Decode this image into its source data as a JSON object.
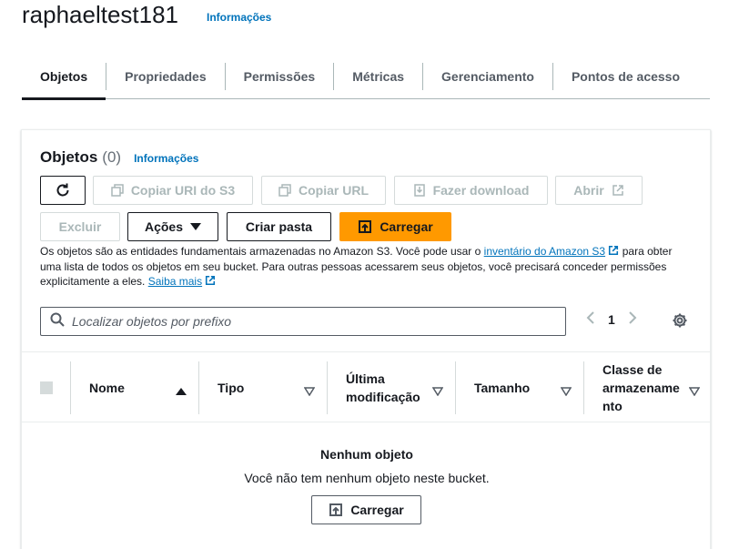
{
  "header": {
    "bucket_name": "raphaeltest181",
    "info_link": "Informações"
  },
  "tabs": [
    {
      "label": "Objetos",
      "active": true
    },
    {
      "label": "Propriedades"
    },
    {
      "label": "Permissões"
    },
    {
      "label": "Métricas"
    },
    {
      "label": "Gerenciamento"
    },
    {
      "label": "Pontos de acesso"
    }
  ],
  "objects_panel": {
    "title": "Objetos",
    "count": "(0)",
    "info_link": "Informações",
    "buttons": {
      "refresh_icon": "refresh-icon",
      "copy_uri": "Copiar URI do S3",
      "copy_url": "Copiar URL",
      "download": "Fazer download",
      "open": "Abrir",
      "delete": "Excluir",
      "actions": "Ações",
      "create_folder": "Criar pasta",
      "upload": "Carregar"
    },
    "description": {
      "part1": "Os objetos são as entidades fundamentais armazenadas no Amazon S3. Você pode usar o ",
      "link1": "inventário do Amazon S3",
      "part2": " para obter uma lista de todos os objetos em seu bucket. Para outras pessoas acessarem seus objetos, você precisará conceder permissões explicitamente a eles. ",
      "link2": "Saiba mais"
    },
    "search": {
      "placeholder": "Localizar objetos por prefixo"
    },
    "pagination": {
      "current_page": "1"
    },
    "table": {
      "columns": {
        "name": "Nome",
        "type": "Tipo",
        "modified_1": "Última",
        "modified_2": "modificação",
        "size": "Tamanho",
        "class_1": "Classe de",
        "class_2": "armazename",
        "class_3": "nto"
      }
    },
    "empty_state": {
      "title": "Nenhum objeto",
      "description": "Você não tem nenhum objeto neste bucket.",
      "upload_button": "Carregar"
    }
  },
  "colors": {
    "primary": "#ff9900",
    "link": "#0073bb",
    "text": "#16191f",
    "muted": "#545b64",
    "disabled": "#aab7b8"
  }
}
